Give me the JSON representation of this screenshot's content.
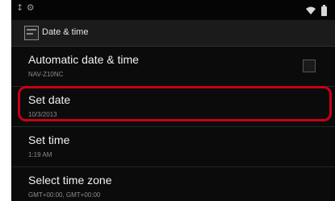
{
  "status_bar": {
    "left_icons": "↕ ⚙",
    "wifi_icon": "wifi-icon",
    "battery_icon": "battery-icon"
  },
  "action_bar": {
    "title": "Date & time"
  },
  "settings": [
    {
      "title": "Automatic date & time",
      "summary": "NAV-Z10NC"
    },
    {
      "title": "Set date",
      "summary": "10/3/2013"
    },
    {
      "title": "Set time",
      "summary": "1:19 AM"
    },
    {
      "title": "Select time zone",
      "summary": "GMT+00:00, GMT+00:00"
    }
  ],
  "highlight_color": "#c90014"
}
